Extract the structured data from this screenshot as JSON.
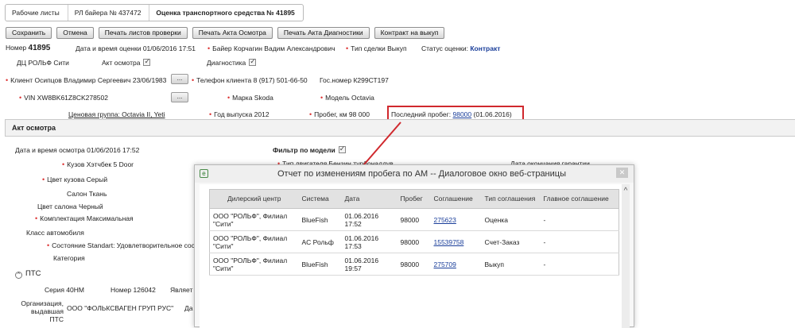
{
  "breadcrumbs": [
    "Рабочие листы",
    "РЛ байера № 437472",
    "Оценка транспортного средства № 41895"
  ],
  "toolbar": {
    "save": "Сохранить",
    "cancel": "Отмена",
    "print_check": "Печать листов проверки",
    "print_inspection": "Печать Акта Осмотра",
    "print_diag": "Печать Акта Диагностики",
    "contract": "Контракт на выкуп"
  },
  "header": {
    "number_label": "Номер",
    "number_value": "41895",
    "eval_datetime": "Дата и время оценки 01/06/2016 17:51",
    "buyer": "Байер Корчагин Вадим Александрович",
    "deal_type": "Тип сделки Выкуп",
    "status_label": "Статус оценки:",
    "status_value": "Контракт",
    "dealer": "ДЦ РОЛЬФ Сити",
    "inspection_act": "Акт осмотра",
    "diagnostics": "Диагностика",
    "client": "Клиент Осипцов Владимир Сергеевич 23/06/1983",
    "client_phone": "Телефон клиента 8 (917) 501-66-50",
    "gos_number": "Гос.номер К299СТ197",
    "vin": "VIN XW8BK61Z8CK278502",
    "brand": "Марка Skoda",
    "model": "Модель Octavia",
    "price_group": "Ценовая группа: Octavia II, Yeti",
    "year": "Год выпуска 2012",
    "mileage": "Пробег, км 98 000",
    "last_mileage_label": "Последний пробег:",
    "last_mileage_link": "98000",
    "last_mileage_date": "(01.06.2016)",
    "dots": "..."
  },
  "section": {
    "title": "Акт осмотра",
    "inspection_datetime": "Дата и время осмотра 01/06/2016 17:52",
    "model_filter": "Фильтр по модели",
    "body": "Кузов Хэтчбек 5 Door",
    "engine_type": "Тип двигателя Бензин турбонаддув",
    "warranty_end": "Дата окончания гарантии",
    "body_color": "Цвет кузова Серый",
    "interior": "Салон Ткань",
    "interior_color": "Цвет салона Черный",
    "equipment": "Комплектация Максимальная",
    "car_class": "Класс автомобиля",
    "condition": "Состояние Standart: Удовлетворительное состояние",
    "category": "Категория",
    "pts": "ПТС",
    "series": "Серия 40НМ",
    "pts_number": "Номер 126042",
    "is_label": "Являет",
    "org_label": "Организация, выдавшая ПТС",
    "org_value": "ООО \"ФОЛЬКСВАГЕН ГРУП РУС\"",
    "date_short": "Да"
  },
  "modal": {
    "title": "Отчет по изменениям пробега по АМ -- Диалоговое окно веб-страницы",
    "close": "✕",
    "columns": [
      "Дилерский центр",
      "Система",
      "Дата",
      "Пробег",
      "Соглашение",
      "Тип соглашения",
      "Главное соглашение"
    ],
    "rows": [
      {
        "dealer": "ООО \"РОЛЬФ\", Филиал \"Сити\"",
        "system": "BlueFish",
        "date": "01.06.2016 17:52",
        "mileage": "98000",
        "agreement": "275623",
        "type": "Оценка",
        "main": "-"
      },
      {
        "dealer": "ООО \"РОЛЬФ\", Филиал \"Сити\"",
        "system": "AC Рольф",
        "date": "01.06.2016 17:53",
        "mileage": "98000",
        "agreement": "15539758",
        "type": "Счет-Заказ",
        "main": "-"
      },
      {
        "dealer": "ООО \"РОЛЬФ\", Филиал \"Сити\"",
        "system": "BlueFish",
        "date": "01.06.2016 19:57",
        "mileage": "98000",
        "agreement": "275709",
        "type": "Выкуп",
        "main": "-"
      }
    ]
  },
  "colors": {
    "highlight": "#d0282d",
    "link": "#1a3e9a",
    "required": "#dd3333"
  }
}
